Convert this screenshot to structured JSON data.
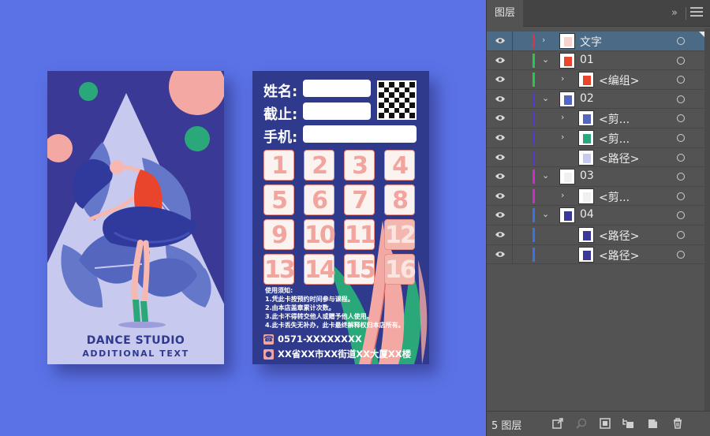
{
  "card_front": {
    "title": "DANCE STUDIO",
    "subtitle": "ADDITIONAL TEXT"
  },
  "card_back": {
    "fields": [
      "姓名:",
      "截止:",
      "手机:"
    ],
    "stamps": [
      "1",
      "2",
      "3",
      "4",
      "5",
      "6",
      "7",
      "8",
      "9",
      "10",
      "11",
      "12",
      "13",
      "14",
      "15",
      "16"
    ],
    "notes_title": "使用须知:",
    "notes": [
      "1.凭此卡按预约时间参与课程。",
      "2.由本店盖章累计次数。",
      "3.此卡不得转交他人或赠予他人使用。",
      "4.此卡丢失无补办，此卡最终解释权归本店所有。"
    ],
    "phone": "0571-XXXXXXXX",
    "address": "XX省XX市XX街道XX大厦XX楼"
  },
  "layers_panel": {
    "tab_label": "图层",
    "collapse_icon": "»",
    "menu_icon": "hamburger-icon",
    "layer_count": "5 图层",
    "rows": [
      {
        "name": "文字",
        "depth": 0,
        "twisty": "›",
        "color": "#e0304a",
        "selected": true
      },
      {
        "name": "01",
        "depth": 0,
        "twisty": "⌄",
        "color": "#27c94a",
        "selected": false
      },
      {
        "name": "<编组>",
        "depth": 1,
        "twisty": "›",
        "color": "#27c94a",
        "selected": false
      },
      {
        "name": "02",
        "depth": 0,
        "twisty": "⌄",
        "color": "#5a35d6",
        "selected": false
      },
      {
        "name": "<剪...",
        "depth": 1,
        "twisty": "›",
        "color": "#5a35d6",
        "selected": false
      },
      {
        "name": "<剪...",
        "depth": 1,
        "twisty": "›",
        "color": "#5a35d6",
        "selected": false
      },
      {
        "name": "<路径>",
        "depth": 1,
        "twisty": "",
        "color": "#5a35d6",
        "selected": false
      },
      {
        "name": "03",
        "depth": 0,
        "twisty": "⌄",
        "color": "#d02ccd",
        "selected": false
      },
      {
        "name": "<剪...",
        "depth": 1,
        "twisty": "›",
        "color": "#d02ccd",
        "selected": false
      },
      {
        "name": "04",
        "depth": 0,
        "twisty": "⌄",
        "color": "#3a73e6",
        "selected": false
      },
      {
        "name": "<路径>",
        "depth": 1,
        "twisty": "",
        "color": "#3a73e6",
        "selected": false
      },
      {
        "name": "<路径>",
        "depth": 1,
        "twisty": "",
        "color": "#3a73e6",
        "selected": false
      }
    ]
  }
}
